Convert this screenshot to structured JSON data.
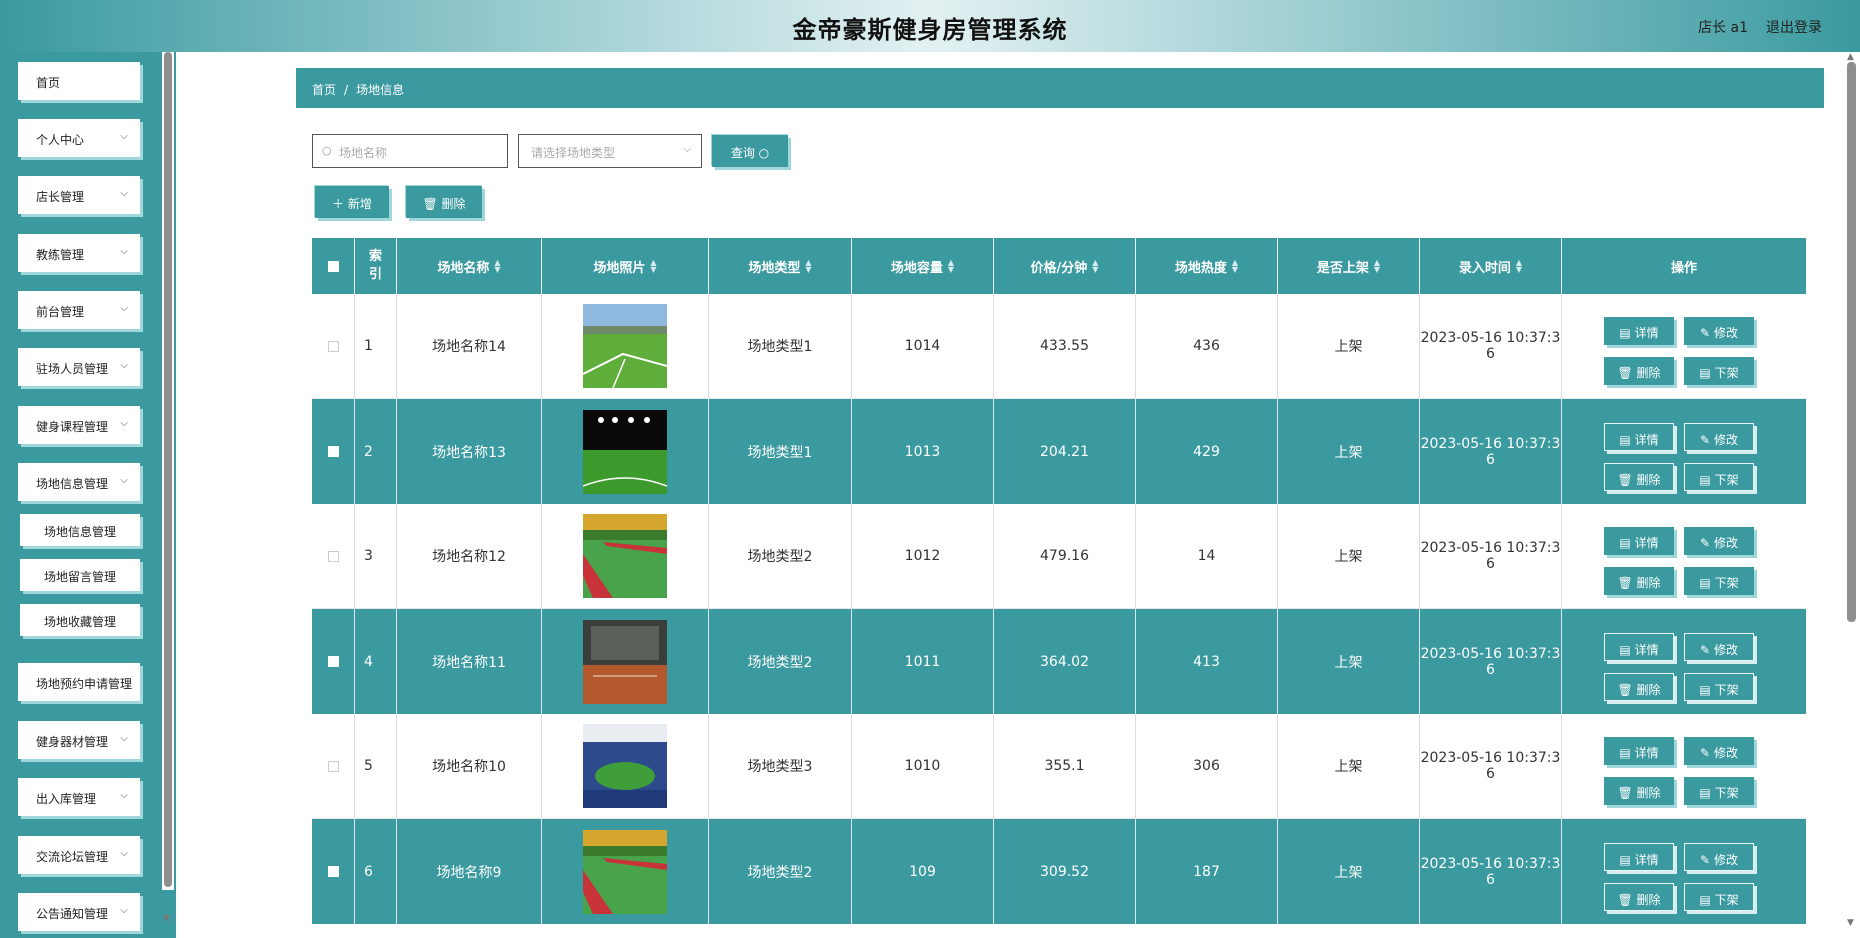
{
  "header": {
    "title": "金帝豪斯健身房管理系统",
    "user": "店长 a1",
    "logout": "退出登录"
  },
  "sidebar": {
    "items": [
      {
        "label": "首页",
        "has_children": false
      },
      {
        "label": "个人中心",
        "has_children": true
      },
      {
        "label": "店长管理",
        "has_children": true
      },
      {
        "label": "教练管理",
        "has_children": true
      },
      {
        "label": "前台管理",
        "has_children": true
      },
      {
        "label": "驻场人员管理",
        "has_children": true
      },
      {
        "label": "健身课程管理",
        "has_children": true
      },
      {
        "label": "场地信息管理",
        "has_children": true
      }
    ],
    "sub_items": [
      "场地信息管理",
      "场地留言管理",
      "场地收藏管理"
    ],
    "items_after": [
      {
        "label": "场地预约申请管理",
        "has_children": false
      },
      {
        "label": "健身器材管理",
        "has_children": true
      },
      {
        "label": "出入库管理",
        "has_children": true
      },
      {
        "label": "交流论坛管理",
        "has_children": true
      },
      {
        "label": "公告通知管理",
        "has_children": true
      }
    ]
  },
  "breadcrumb": {
    "home": "首页",
    "separator": "/",
    "current": "场地信息"
  },
  "search": {
    "name_placeholder": "场地名称",
    "type_placeholder": "请选择场地类型",
    "query_label": "查询"
  },
  "toolbar": {
    "add_label": "新增",
    "delete_label": "删除"
  },
  "table": {
    "headers": [
      "索引",
      "场地名称",
      "场地照片",
      "场地类型",
      "场地容量",
      "价格/分钟",
      "场地热度",
      "是否上架",
      "录入时间",
      "操作"
    ],
    "rows": [
      {
        "index": "1",
        "name": "场地名称14",
        "photo": "grass-field-sunny",
        "type": "场地类型1",
        "capacity": "1014",
        "price": "433.55",
        "heat": "436",
        "status": "上架",
        "time_a": "2023-05-16 10:37:3",
        "time_b": "6"
      },
      {
        "index": "2",
        "name": "场地名称13",
        "photo": "night-stadium",
        "type": "场地类型1",
        "capacity": "1013",
        "price": "204.21",
        "heat": "429",
        "status": "上架",
        "time_a": "2023-05-16 10:37:3",
        "time_b": "6"
      },
      {
        "index": "3",
        "name": "场地名称12",
        "photo": "red-track-field",
        "type": "场地类型2",
        "capacity": "1012",
        "price": "479.16",
        "heat": "14",
        "status": "上架",
        "time_a": "2023-05-16 10:37:3",
        "time_b": "6"
      },
      {
        "index": "4",
        "name": "场地名称11",
        "photo": "clay-court",
        "type": "场地类型2",
        "capacity": "1011",
        "price": "364.02",
        "heat": "413",
        "status": "上架",
        "time_a": "2023-05-16 10:37:3",
        "time_b": "6"
      },
      {
        "index": "5",
        "name": "场地名称10",
        "photo": "stadium-stands",
        "type": "场地类型3",
        "capacity": "1010",
        "price": "355.1",
        "heat": "306",
        "status": "上架",
        "time_a": "2023-05-16 10:37:3",
        "time_b": "6"
      },
      {
        "index": "6",
        "name": "场地名称9",
        "photo": "red-track-field",
        "type": "场地类型2",
        "capacity": "109",
        "price": "309.52",
        "heat": "187",
        "status": "上架",
        "time_a": "2023-05-16 10:37:3",
        "time_b": "6"
      }
    ],
    "actions": {
      "detail": "详情",
      "edit": "修改",
      "delete": "删除",
      "unpublish": "下架"
    }
  },
  "colors": {
    "accent": "#3a9aa0",
    "accent_light": "#9fd7db"
  }
}
